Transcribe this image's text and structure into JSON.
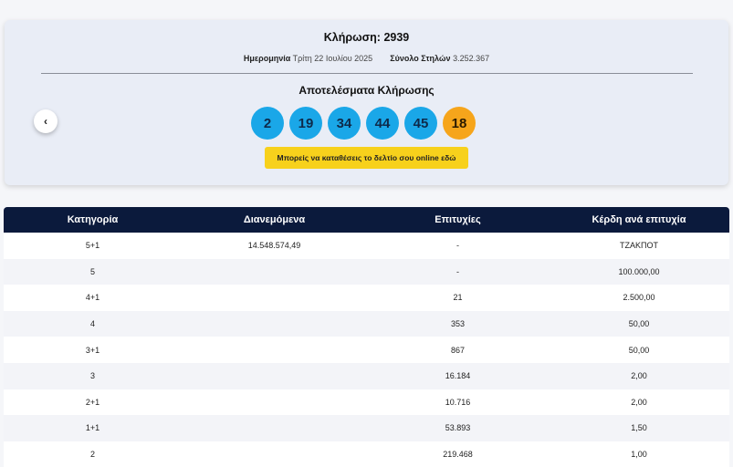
{
  "draw": {
    "title": "Κλήρωση: 2939",
    "date_label": "Ημερομηνία",
    "date_value": "Τρίτη 22 Ιουλίου 2025",
    "columns_label": "Σύνολο Στηλών",
    "columns_value": "3.252.367",
    "results_title": "Αποτελέσματα Κλήρωσης",
    "numbers": [
      "2",
      "19",
      "34",
      "44",
      "45"
    ],
    "bonus": "18",
    "prev_icon": "chevron-left-icon",
    "prev_glyph": "‹",
    "online_button": "Μπορείς να καταθέσεις το δελτίο σου online εδώ",
    "colors": {
      "ball": "#1aa7e8",
      "bonus": "#f6a51b",
      "button": "#f7d11c",
      "header": "#0b1a3c"
    }
  },
  "table": {
    "headers": [
      "Κατηγορία",
      "Διανεμόμενα",
      "Επιτυχίες",
      "Κέρδη ανά επιτυχία"
    ],
    "rows": [
      {
        "category": "5+1",
        "distributed": "14.548.574,49",
        "winners": "-",
        "prize": "ΤΖΑΚΠΟΤ"
      },
      {
        "category": "5",
        "distributed": "",
        "winners": "-",
        "prize": "100.000,00"
      },
      {
        "category": "4+1",
        "distributed": "",
        "winners": "21",
        "prize": "2.500,00"
      },
      {
        "category": "4",
        "distributed": "",
        "winners": "353",
        "prize": "50,00"
      },
      {
        "category": "3+1",
        "distributed": "",
        "winners": "867",
        "prize": "50,00"
      },
      {
        "category": "3",
        "distributed": "",
        "winners": "16.184",
        "prize": "2,00"
      },
      {
        "category": "2+1",
        "distributed": "",
        "winners": "10.716",
        "prize": "2,00"
      },
      {
        "category": "1+1",
        "distributed": "",
        "winners": "53.893",
        "prize": "1,50"
      },
      {
        "category": "2",
        "distributed": "",
        "winners": "219.468",
        "prize": "1,00"
      }
    ]
  }
}
